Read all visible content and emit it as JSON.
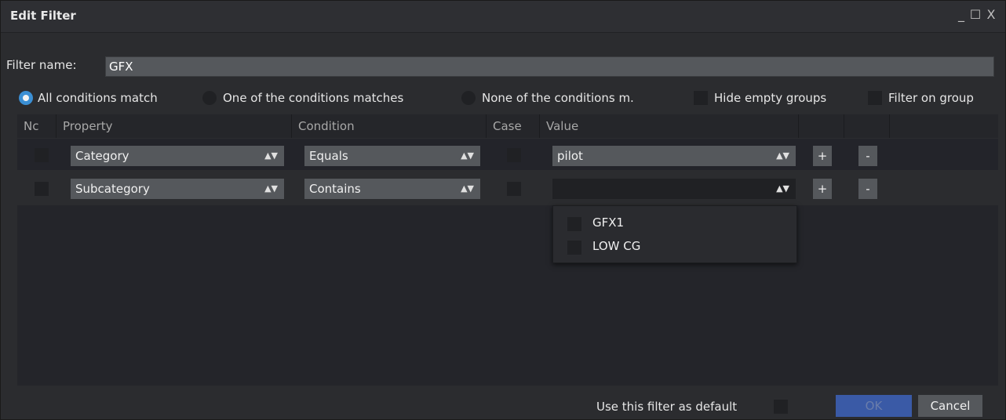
{
  "window": {
    "title": "Edit Filter",
    "minimize": "_",
    "maximize": "☐",
    "close": "X"
  },
  "filter_name": {
    "label": "Filter name:",
    "value": "GFX"
  },
  "options": {
    "all": "All conditions match",
    "one": "One of the conditions matches",
    "none": "None of the conditions m.",
    "hide_empty": "Hide empty groups",
    "filter_group": "Filter on group"
  },
  "columns": {
    "not": "Nc",
    "property": "Property",
    "condition": "Condition",
    "case": "Case",
    "value": "Value"
  },
  "rows": [
    {
      "property": "Category",
      "condition": "Equals",
      "value": "pilot",
      "add": "+",
      "remove": "-"
    },
    {
      "property": "Subcategory",
      "condition": "Contains",
      "value": "",
      "add": "+",
      "remove": "-"
    }
  ],
  "dropdown": {
    "items": [
      "GFX1",
      "LOW CG"
    ]
  },
  "footer": {
    "default_label": "Use this filter as default",
    "ok": "OK",
    "cancel": "Cancel"
  }
}
